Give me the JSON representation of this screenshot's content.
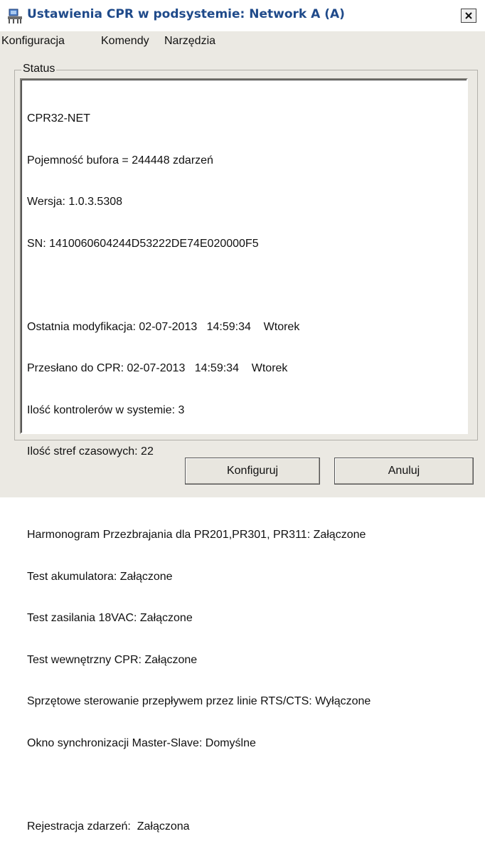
{
  "window": {
    "title": "Ustawienia CPR w podsystemie: Network A (A)",
    "icon": "network-app-icon",
    "close_icon": "close-icon"
  },
  "menu": {
    "items": [
      "Konfiguracja",
      "Komendy",
      "Narzędzia"
    ]
  },
  "status": {
    "group_label": "Status",
    "lines": [
      "CPR32-NET",
      "Pojemność bufora = 244448 zdarzeń",
      "Wersja: 1.0.3.5308",
      "SN: 1410060604244D53222DE74E020000F5",
      "",
      "Ostatnia modyfikacja: 02-07-2013   14:59:34    Wtorek",
      "Przesłano do CPR: 02-07-2013   14:59:34    Wtorek",
      "Ilość kontrolerów w systemie: 3",
      "Ilość stref czasowych: 22",
      "",
      "Harmonogram Przezbrajania dla PR201,PR301, PR311: Załączone",
      "Test akumulatora: Załączone",
      "Test zasilania 18VAC: Załączone",
      "Test wewnętrzny CPR: Załączone",
      "Sprzętowe sterowanie przepływem przez linie RTS/CTS: Wyłączone",
      "Okno synchronizacji Master-Slave: Domyślne",
      "",
      "Rejestracja zdarzeń:  Załączona"
    ]
  },
  "buttons": {
    "configure": "Konfiguruj",
    "cancel": "Anuluj"
  },
  "colors": {
    "title_text": "#1f4a8a",
    "window_bg": "#ebe9e3"
  }
}
